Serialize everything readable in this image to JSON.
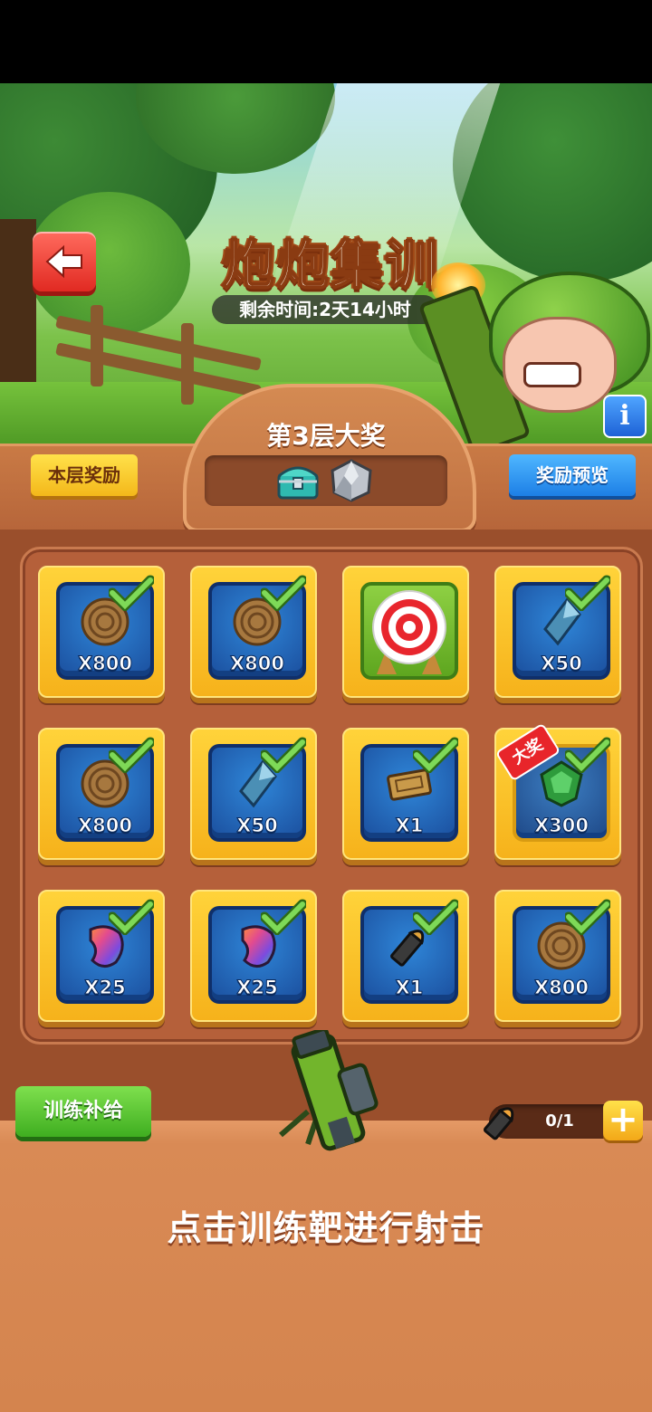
{
  "header": {
    "title": "炮炮集训",
    "timer": "剩余时间:2天14小时"
  },
  "floor": {
    "label": "第3层大奖",
    "rewards": [
      "chest-icon",
      "stone-icon"
    ]
  },
  "buttons": {
    "floor_rewards": "本层奖励",
    "reward_preview": "奖励预览",
    "training_supply": "训练补给",
    "info": "i",
    "plus": "+"
  },
  "grid": {
    "rows": [
      [
        {
          "item": "wood-icon",
          "qty": "X800",
          "claimed": true
        },
        {
          "item": "wood-icon",
          "qty": "X800",
          "claimed": true
        },
        {
          "item": "target-icon",
          "qty": "",
          "claimed": false
        },
        {
          "item": "crystal-icon",
          "qty": "X50",
          "claimed": true
        }
      ],
      [
        {
          "item": "wood-icon",
          "qty": "X800",
          "claimed": true
        },
        {
          "item": "crystal-icon",
          "qty": "X50",
          "claimed": true
        },
        {
          "item": "ticket-icon",
          "qty": "X1",
          "claimed": true
        },
        {
          "item": "emerald-icon",
          "qty": "X300",
          "claimed": true,
          "badge": "大奖"
        }
      ],
      [
        {
          "item": "rainbow-bean-icon",
          "qty": "X25",
          "claimed": true
        },
        {
          "item": "rainbow-bean-icon",
          "qty": "X25",
          "claimed": true
        },
        {
          "item": "bullet-icon",
          "qty": "X1",
          "claimed": true
        },
        {
          "item": "wood-icon",
          "qty": "X800",
          "claimed": true
        }
      ]
    ]
  },
  "ammo": {
    "count": "0/1"
  },
  "hint": "点击训练靶进行射击",
  "colors": {
    "tile_yellow": "#f6b21b",
    "tile_blue": "#2f86d8",
    "check_green": "#7ed957",
    "board_brown": "#b5603a"
  }
}
